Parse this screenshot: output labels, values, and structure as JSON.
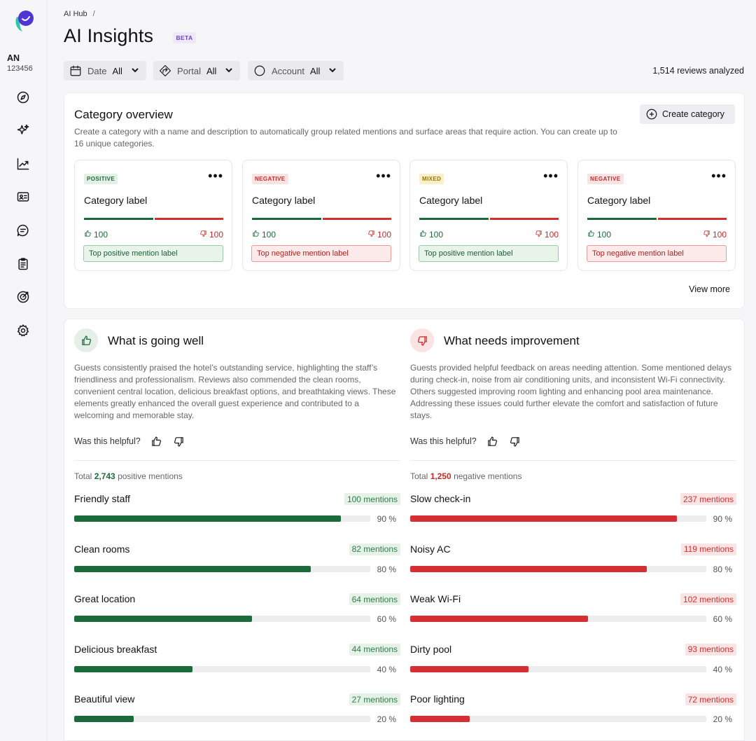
{
  "account": {
    "initials": "AN",
    "id": "123456"
  },
  "breadcrumb": {
    "root": "AI Hub",
    "separator": "/"
  },
  "page": {
    "title": "AI Insights",
    "badge": "BETA"
  },
  "filters": [
    {
      "label": "Date",
      "value": "All",
      "icon": "calendar-icon"
    },
    {
      "label": "Portal",
      "value": "All",
      "icon": "portal-icon"
    },
    {
      "label": "Account",
      "value": "All",
      "icon": "circle-icon"
    }
  ],
  "reviews_analyzed": "1,514 reviews analyzed",
  "category_overview": {
    "title": "Category overview",
    "description": "Create a category with a name and description to automatically group related mentions and surface areas that require action. You can create up to 16 unique categories.",
    "create_label": "Create category",
    "view_more": "View more",
    "cards": [
      {
        "badge": "POSITIVE",
        "kind": "pos",
        "label": "Category label",
        "up": "100",
        "down": "100",
        "mention": "Top positive mention label"
      },
      {
        "badge": "NEGATIVE",
        "kind": "neg",
        "label": "Category label",
        "up": "100",
        "down": "100",
        "mention": "Top negative mention label"
      },
      {
        "badge": "MIXED",
        "kind": "mix",
        "label": "Category label",
        "up": "100",
        "down": "100",
        "mention": "Top positive mention label"
      },
      {
        "badge": "NEGATIVE",
        "kind": "neg",
        "label": "Category label",
        "up": "100",
        "down": "100",
        "mention": "Top negative mention label"
      }
    ]
  },
  "going_well": {
    "title": "What is going well",
    "description": "Guests consistently praised the hotel’s outstanding service, highlighting the staff’s friendliness and professionalism. Reviews also commended the clean rooms, convenient central location, delicious breakfast options, and breathtaking views. These elements greatly enhanced the overall guest experience and contributed to a welcoming and memorable stay.",
    "helpful": "Was this helpful?",
    "total_prefix": "Total",
    "total_value": "2,743",
    "total_suffix": "positive mentions",
    "items": [
      {
        "name": "Friendly staff",
        "mentions": "100 mentions",
        "percent": 90,
        "pct_label": "90 %"
      },
      {
        "name": "Clean rooms",
        "mentions": "82 mentions",
        "percent": 80,
        "pct_label": "80 %"
      },
      {
        "name": "Great location",
        "mentions": "64 mentions",
        "percent": 60,
        "pct_label": "60 %"
      },
      {
        "name": "Delicious breakfast",
        "mentions": "44 mentions",
        "percent": 40,
        "pct_label": "40 %"
      },
      {
        "name": "Beautiful view",
        "mentions": "27 mentions",
        "percent": 20,
        "pct_label": "20 %"
      }
    ]
  },
  "needs_improvement": {
    "title": "What needs improvement",
    "description": "Guests provided helpful feedback on areas needing attention. Some mentioned delays during check-in, noise from air conditioning units, and inconsistent Wi-Fi connectivity. Others suggested improving room lighting and enhancing pool area maintenance. Addressing these issues could further elevate the comfort and satisfaction of future stays.",
    "helpful": "Was this helpful?",
    "total_prefix": "Total",
    "total_value": "1,250",
    "total_suffix": "negative mentions",
    "items": [
      {
        "name": "Slow check-in",
        "mentions": "237 mentions",
        "percent": 90,
        "pct_label": "90 %"
      },
      {
        "name": "Noisy AC",
        "mentions": "119 mentions",
        "percent": 80,
        "pct_label": "80 %"
      },
      {
        "name": "Weak Wi-Fi",
        "mentions": "102 mentions",
        "percent": 60,
        "pct_label": "60 %"
      },
      {
        "name": "Dirty pool",
        "mentions": "93 mentions",
        "percent": 40,
        "pct_label": "40 %"
      },
      {
        "name": "Poor lighting",
        "mentions": "72 mentions",
        "percent": 20,
        "pct_label": "20 %"
      }
    ]
  },
  "colors": {
    "positive": "#1b6a3a",
    "negative": "#d62f33",
    "accent": "#6b46c1"
  }
}
